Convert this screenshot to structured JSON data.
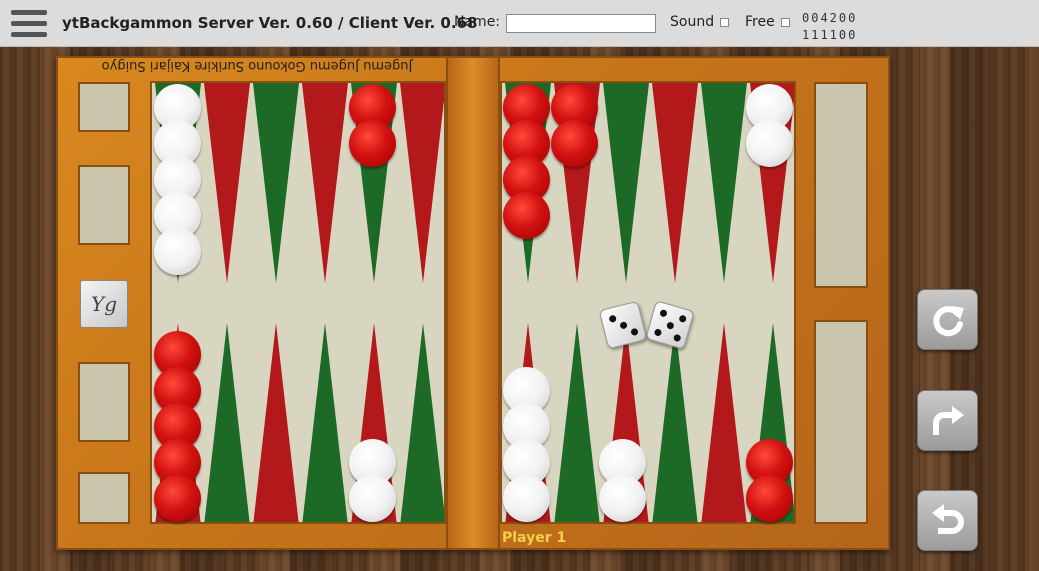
{
  "header": {
    "title": "ytBackgammon Server Ver. 0.60 / Client Ver. 0.68",
    "name_label": "Name:",
    "name_value": "",
    "sound_label": "Sound",
    "free_label": "Free",
    "score_top": "004200",
    "score_bottom": "111100"
  },
  "board": {
    "inverted_label": "Jugemu Jugemu Gokouno Surikire Kaijari Suigyo",
    "player_label": "Player 1",
    "cube_label": "Yg",
    "dice": [
      3,
      5
    ],
    "colors": {
      "red": "#d41111",
      "white": "#f2f2f2",
      "point_red": "#b3181b",
      "point_green": "#1d6a26"
    }
  },
  "controls": [
    {
      "name": "refresh",
      "icon": "refresh-icon"
    },
    {
      "name": "redo",
      "icon": "redo-icon"
    },
    {
      "name": "undo",
      "icon": "undo-icon"
    }
  ]
}
